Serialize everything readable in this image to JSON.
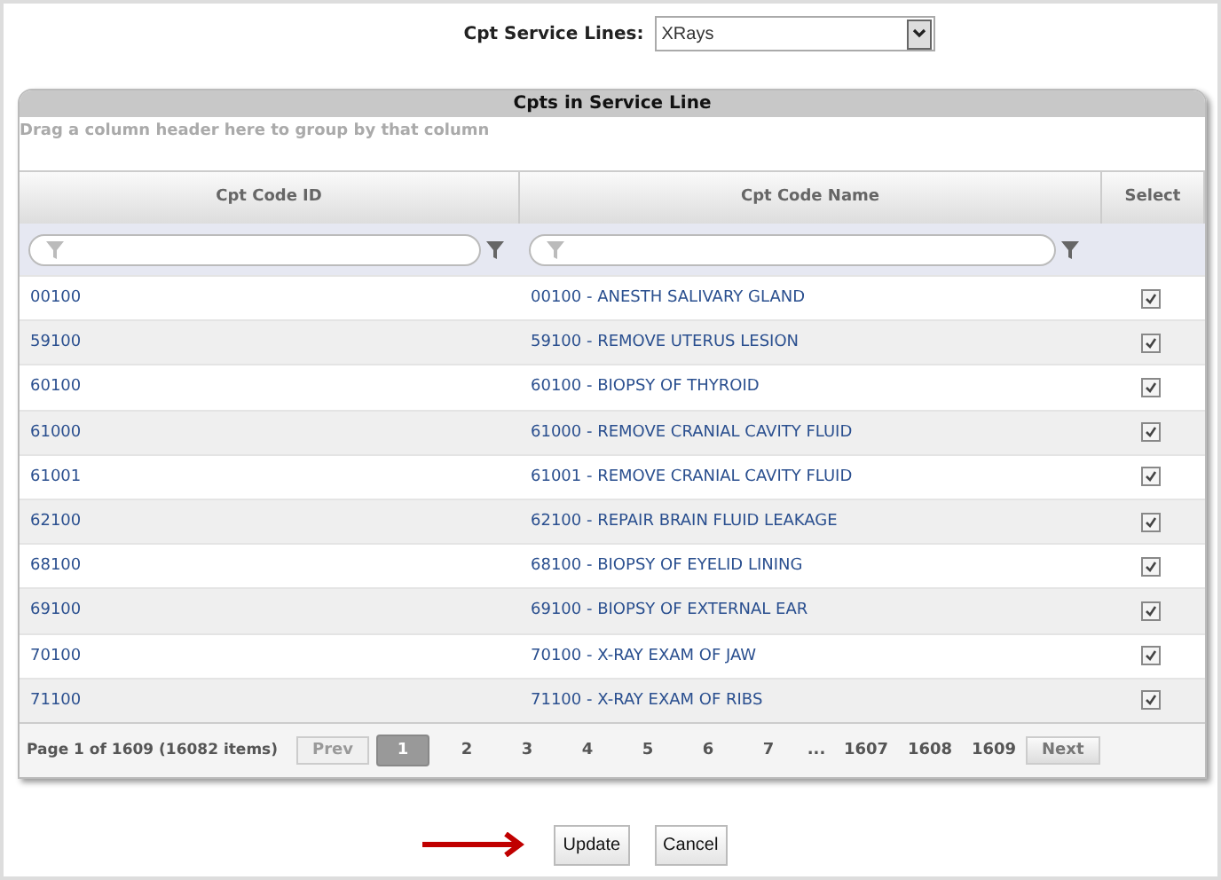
{
  "service_line": {
    "label": "Cpt Service Lines:",
    "value": "XRays"
  },
  "grid": {
    "title": "Cpts in Service Line",
    "group_hint": "Drag a column header here to group by that column",
    "columns": [
      "Cpt Code ID",
      "Cpt Code Name",
      "Select"
    ],
    "rows": [
      {
        "id": "00100",
        "name": "00100 - ANESTH SALIVARY GLAND",
        "checked": true
      },
      {
        "id": "59100",
        "name": "59100 - REMOVE UTERUS LESION",
        "checked": true
      },
      {
        "id": "60100",
        "name": "60100 - BIOPSY OF THYROID",
        "checked": true
      },
      {
        "id": "61000",
        "name": "61000 - REMOVE CRANIAL CAVITY FLUID",
        "checked": true
      },
      {
        "id": "61001",
        "name": "61001 - REMOVE CRANIAL CAVITY FLUID",
        "checked": true
      },
      {
        "id": "62100",
        "name": "62100 - REPAIR BRAIN FLUID LEAKAGE",
        "checked": true
      },
      {
        "id": "68100",
        "name": "68100 - BIOPSY OF EYELID LINING",
        "checked": true
      },
      {
        "id": "69100",
        "name": "69100 - BIOPSY OF EXTERNAL EAR",
        "checked": true
      },
      {
        "id": "70100",
        "name": "70100 - X-RAY EXAM OF JAW",
        "checked": true
      },
      {
        "id": "71100",
        "name": "71100 - X-RAY EXAM OF RIBS",
        "checked": true
      }
    ],
    "pager": {
      "info": "Page 1 of 1609 (16082 items)",
      "prev": {
        "label": "Prev",
        "disabled": true
      },
      "pages": [
        {
          "label": "1",
          "selected": true
        },
        {
          "label": "2",
          "selected": false
        },
        {
          "label": "3",
          "selected": false
        },
        {
          "label": "4",
          "selected": false
        },
        {
          "label": "5",
          "selected": false
        },
        {
          "label": "6",
          "selected": false
        },
        {
          "label": "7",
          "selected": false
        }
      ],
      "ellipsis": "...",
      "last_pages": [
        {
          "label": "1607",
          "selected": false
        },
        {
          "label": "1608",
          "selected": false
        },
        {
          "label": "1609",
          "selected": false
        }
      ],
      "next": {
        "label": "Next",
        "disabled": false
      }
    }
  },
  "buttons": [
    "Update",
    "Cancel"
  ]
}
